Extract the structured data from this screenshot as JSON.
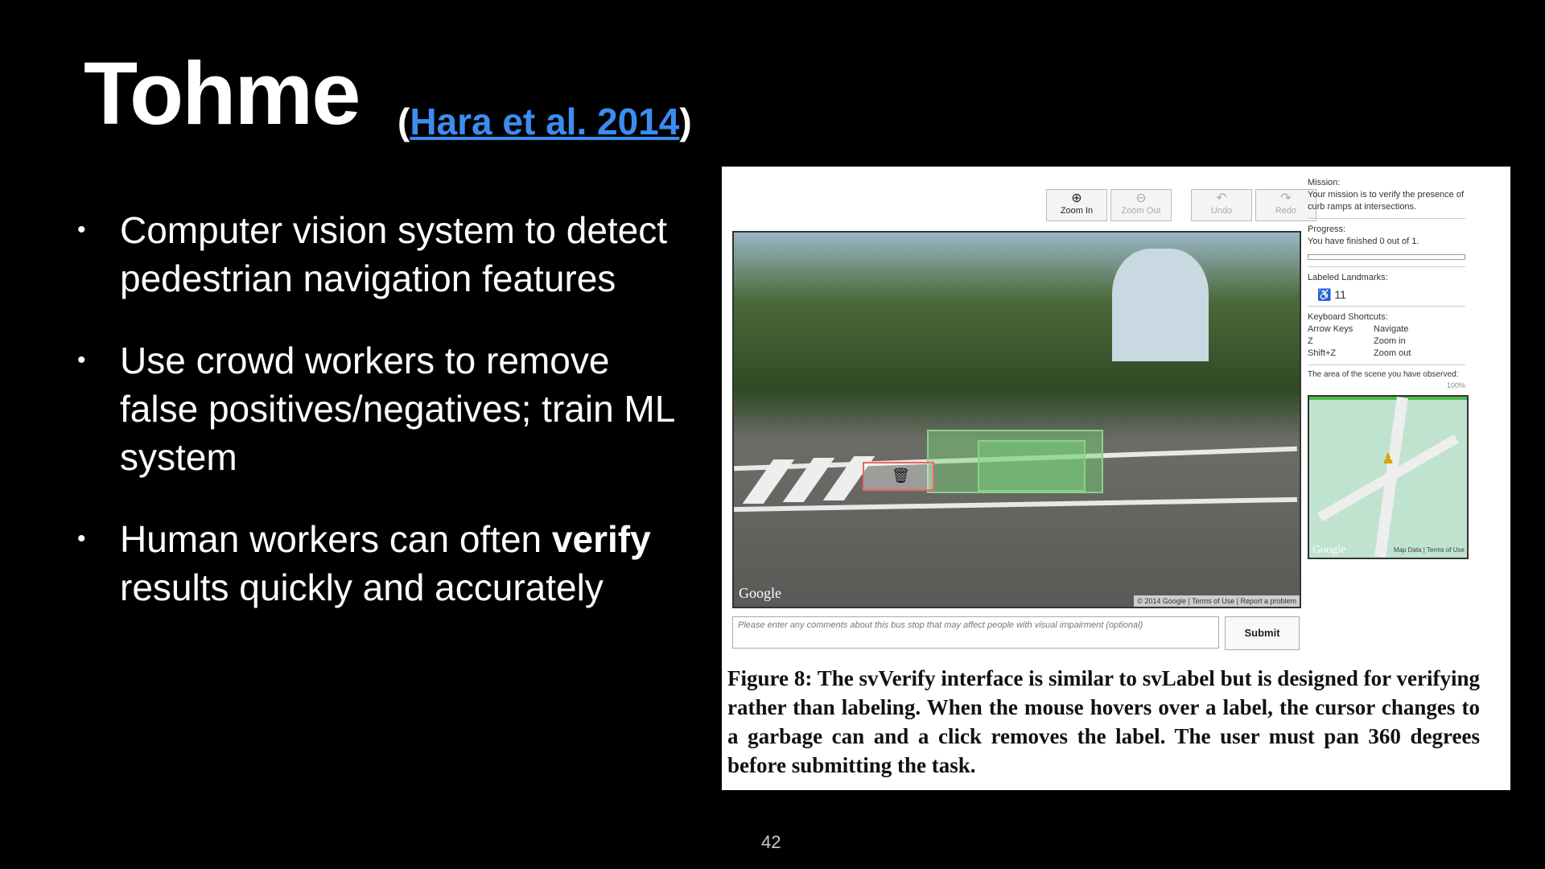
{
  "slide": {
    "title": "Tohme",
    "cite_open": "(",
    "cite_link": "Hara et al. 2014",
    "cite_close": ")",
    "page_number": "42"
  },
  "bullets": [
    {
      "text": "Computer vision system to detect pedestrian navigation features"
    },
    {
      "text": "Use crowd workers to remove false positives/negatives; train ML system"
    },
    {
      "pre": "Human workers can often ",
      "bold": "verify",
      "post": " results quickly and accurately"
    }
  ],
  "figure": {
    "toolbar": {
      "zoom_in": "Zoom In",
      "zoom_out": "Zoom Out",
      "undo": "Undo",
      "redo": "Redo"
    },
    "comment_placeholder": "Please enter any comments about this bus stop that may affect people with visual impairment (optional)",
    "submit": "Submit",
    "google": "Google",
    "copyright": "© 2014 Google | Terms of Use | Report a problem",
    "map_footer": "Map Data | Terms of Use",
    "side": {
      "mission_label": "Mission:",
      "mission_text": "Your mission is to verify the presence of curb ramps at intersections.",
      "progress_label": "Progress:",
      "progress_text": "You have finished 0 out of 1.",
      "progress_value": 0,
      "landmarks_label": "Labeled Landmarks:",
      "landmarks_count": "11",
      "shortcuts_label": "Keyboard Shortcuts:",
      "shortcuts": [
        {
          "key": "Arrow Keys",
          "action": "Navigate"
        },
        {
          "key": "Z",
          "action": "Zoom in"
        },
        {
          "key": "Shift+Z",
          "action": "Zoom out"
        }
      ],
      "observed_label": "The area of the scene you have observed:",
      "observed_pct": "100%"
    },
    "caption": "Figure 8: The svVerify interface is similar to svLabel but is designed for verifying rather than labeling. When the mouse hovers over a label, the cursor changes to a garbage can and a click removes the label. The user must pan 360 degrees before submitting the task."
  }
}
